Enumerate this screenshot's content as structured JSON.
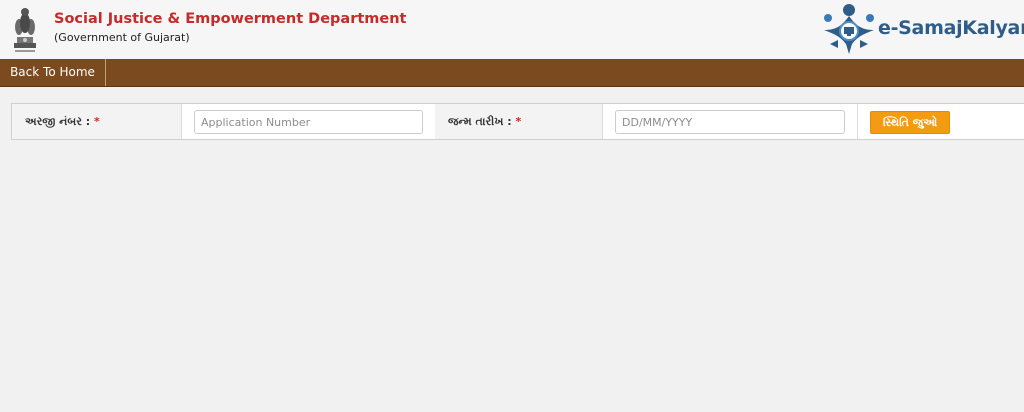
{
  "header": {
    "title": "Social Justice & Empowerment Department",
    "subtitle": "(Government of Gujarat)",
    "emblem_icon": "ashoka-emblem-icon",
    "logo_icon": "e-samajkalyan-logo-icon",
    "logo_text": "e-SamajKalyan"
  },
  "nav": {
    "items": [
      {
        "label": "Back To Home"
      }
    ],
    "background": "#7b4a1f"
  },
  "form": {
    "application_number": {
      "label": "અરજી નંબર :",
      "required_mark": "*",
      "value": "",
      "placeholder": "Application Number"
    },
    "birth_date": {
      "label": "જન્મ તારીખ :",
      "required_mark": "*",
      "value": "",
      "placeholder": "DD/MM/YYYY"
    },
    "submit": {
      "label": "સ્થિતિ જુઓ",
      "color": "#f39c12"
    }
  }
}
